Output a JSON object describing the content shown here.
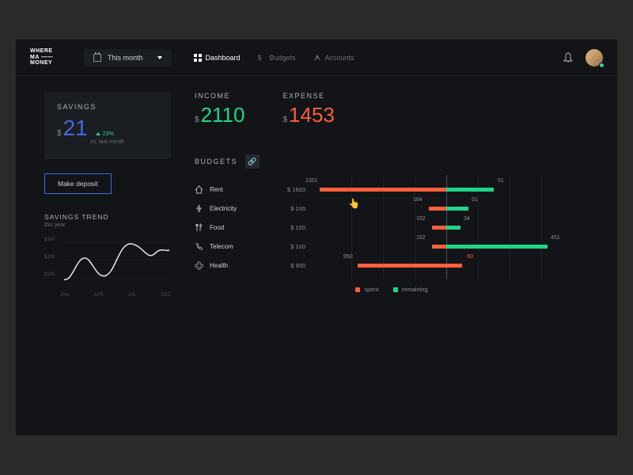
{
  "logo": "WHERE\nMA ——\nMONEY",
  "period": {
    "label": "This month"
  },
  "nav": [
    {
      "label": "Dashboard",
      "active": true
    },
    {
      "label": "Budgets",
      "active": false
    },
    {
      "label": "Accounts",
      "active": false
    }
  ],
  "savings": {
    "label": "SAVINGS",
    "currency": "$",
    "value": "21",
    "delta": "23%",
    "delta_sub": "vs. last month",
    "deposit_btn": "Make deposit"
  },
  "trend": {
    "label": "SAVINGS TREND",
    "sub": "this year",
    "y_ticks": [
      "$300",
      "$200",
      "$100"
    ],
    "x_ticks": [
      "JAN",
      "APR",
      "JUL",
      "DEC"
    ]
  },
  "income": {
    "label": "INCOME",
    "currency": "$",
    "value": "2110"
  },
  "expense": {
    "label": "EXPENSE",
    "currency": "$",
    "value": "1453"
  },
  "budgets": {
    "label": "BUDGETS",
    "items": [
      {
        "icon": "home",
        "name": "Rent",
        "amount": "$ 1600",
        "spent": 1301,
        "remaining": 51
      },
      {
        "icon": "bolt",
        "name": "Electricity",
        "amount": "$ 100",
        "spent": 184,
        "remaining": 51
      },
      {
        "icon": "food",
        "name": "Food",
        "amount": "$ 100",
        "spent": 152,
        "remaining": 34
      },
      {
        "icon": "phone",
        "name": "Telecom",
        "amount": "$ 100",
        "spent": 152,
        "remaining": 451
      },
      {
        "icon": "health",
        "name": "Health",
        "amount": "$ 900",
        "spent": 950,
        "remaining": -50
      }
    ],
    "legend": {
      "spent": "spent",
      "remaining": "remaining"
    }
  },
  "chart_data": {
    "type": "bar",
    "title": "Budgets spent vs remaining",
    "categories": [
      "Rent",
      "Electricity",
      "Food",
      "Telecom",
      "Health"
    ],
    "series": [
      {
        "name": "spent",
        "values": [
          1301,
          184,
          152,
          152,
          950
        ]
      },
      {
        "name": "remaining",
        "values": [
          51,
          51,
          34,
          451,
          -50
        ]
      }
    ],
    "xlabel": "",
    "ylabel": ""
  }
}
